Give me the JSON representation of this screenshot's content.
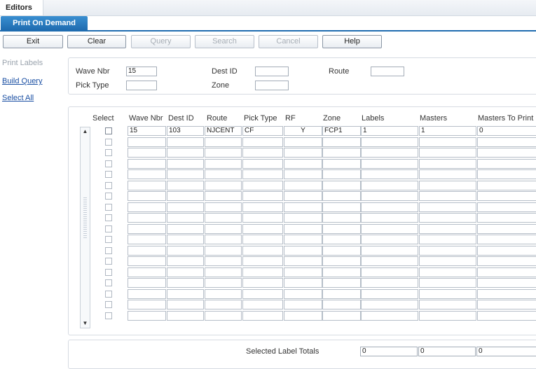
{
  "app": {
    "tab_label": "Editors",
    "page_title": "Print On Demand"
  },
  "toolbar": {
    "exit": "Exit",
    "clear": "Clear",
    "query": "Query",
    "search": "Search",
    "cancel": "Cancel",
    "help": "Help"
  },
  "sidebar": {
    "print_labels": "Print Labels",
    "build_query": "Build Query",
    "select_all": "Select All"
  },
  "filters": {
    "wave_nbr_label": "Wave Nbr",
    "wave_nbr_value": "15",
    "dest_id_label": "Dest ID",
    "dest_id_value": "",
    "route_label": "Route",
    "route_value": "",
    "pick_type_label": "Pick Type",
    "pick_type_value": "",
    "zone_label": "Zone",
    "zone_value": ""
  },
  "grid": {
    "columns": [
      "Select",
      "Wave Nbr",
      "Dest ID",
      "Route",
      "Pick Type",
      "RF",
      "Zone",
      "Labels",
      "Masters",
      "Masters To Print"
    ],
    "rows": [
      {
        "wave_nbr": "15",
        "dest_id": "103",
        "route": "NJCENT",
        "pick_type": "CF",
        "rf": "Y",
        "zone": "FCP1",
        "labels": "1",
        "masters": "1",
        "masters_to_print": "0"
      }
    ],
    "empty_rows": 17
  },
  "totals": {
    "label": "Selected Label Totals",
    "labels": "0",
    "masters": "0",
    "masters_to_print": "0"
  },
  "icons": {
    "scroll_up": "▲",
    "scroll_down": "▼"
  }
}
